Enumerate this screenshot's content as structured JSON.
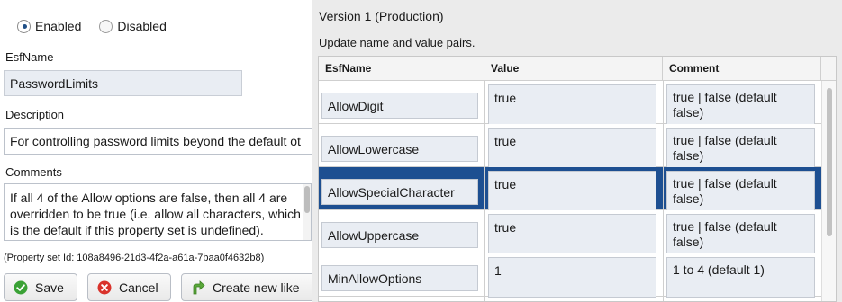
{
  "status": {
    "enabled_label": "Enabled",
    "disabled_label": "Disabled",
    "selected": "Enabled"
  },
  "form": {
    "esfname_label": "EsfName",
    "esfname_value": "PasswordLimits",
    "description_label": "Description",
    "description_value": "For controlling password limits beyond the default ot",
    "comments_label": "Comments",
    "comments_value": "If all 4 of the Allow options are false, then all 4 are overridden to be true (i.e. allow all characters, which is the default if this property set is undefined).",
    "property_set_id": "(Property set Id: 108a8496-21d3-4f2a-a61a-7baa0f4632b8)"
  },
  "buttons": {
    "save": "Save",
    "cancel": "Cancel",
    "create_new_like": "Create new like"
  },
  "version": {
    "title": "Version 1 (Production)",
    "instructions": "Update name and value pairs."
  },
  "grid": {
    "headers": {
      "name": "EsfName",
      "value": "Value",
      "comment": "Comment"
    },
    "rows": [
      {
        "name": "AllowDigit",
        "value": "true",
        "comment": "true | false (default false)",
        "selected": false
      },
      {
        "name": "AllowLowercase",
        "value": "true",
        "comment": "true | false (default false)",
        "selected": false
      },
      {
        "name": "AllowSpecialCharacter",
        "value": "true",
        "comment": "true | false (default false)",
        "selected": true
      },
      {
        "name": "AllowUppercase",
        "value": "true",
        "comment": "true | false (default false)",
        "selected": false
      },
      {
        "name": "MinAllowOptions",
        "value": "1",
        "comment": "1 to 4 (default 1)",
        "selected": false
      }
    ]
  },
  "colors": {
    "selection": "#1d4f91",
    "field_bg": "#e9edf3",
    "panel_bg": "#ebebeb"
  }
}
